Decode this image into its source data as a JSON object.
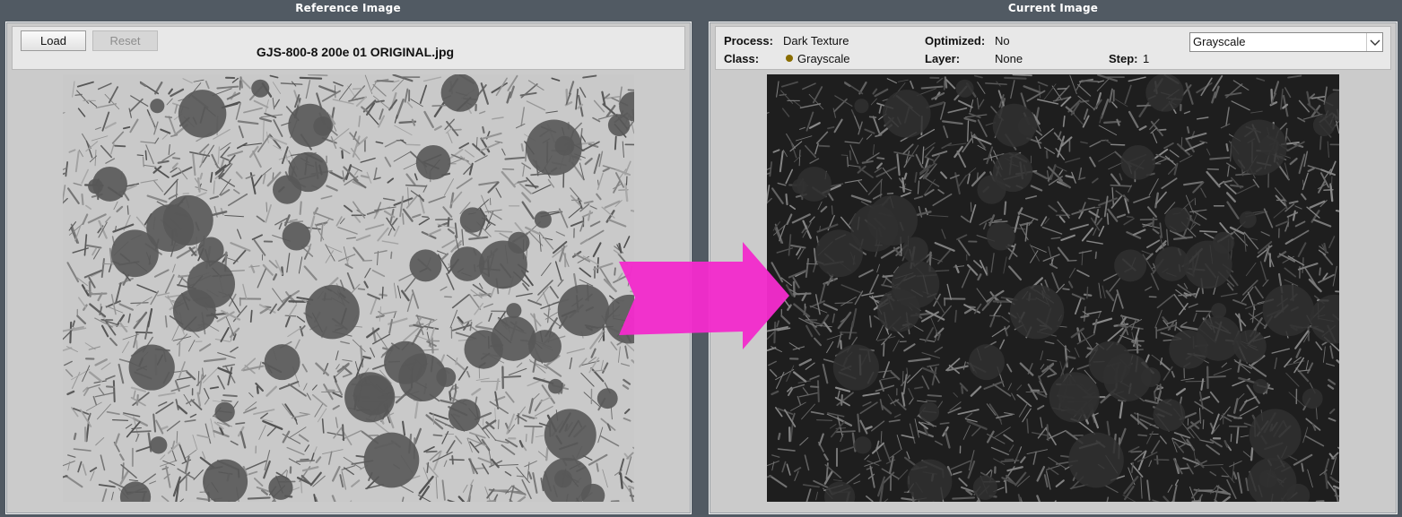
{
  "reference": {
    "title": "Reference Image",
    "load_label": "Load",
    "reset_label": "Reset",
    "filename": "GJS-800-8 200e 01 ORIGINAL.jpg"
  },
  "current": {
    "title": "Current Image",
    "process_label": "Process:",
    "process_value": "Dark Texture",
    "class_label": "Class:",
    "class_value": "Grayscale",
    "class_dot_color": "#8a6d00",
    "optimized_label": "Optimized:",
    "optimized_value": "No",
    "layer_label": "Layer:",
    "layer_value": "None",
    "step_label": "Step:",
    "step_value": "1",
    "view_select_value": "Grayscale"
  },
  "colors": {
    "background": "#515a63",
    "panel": "#cbcbcb",
    "arrow": "#f22ccc"
  }
}
